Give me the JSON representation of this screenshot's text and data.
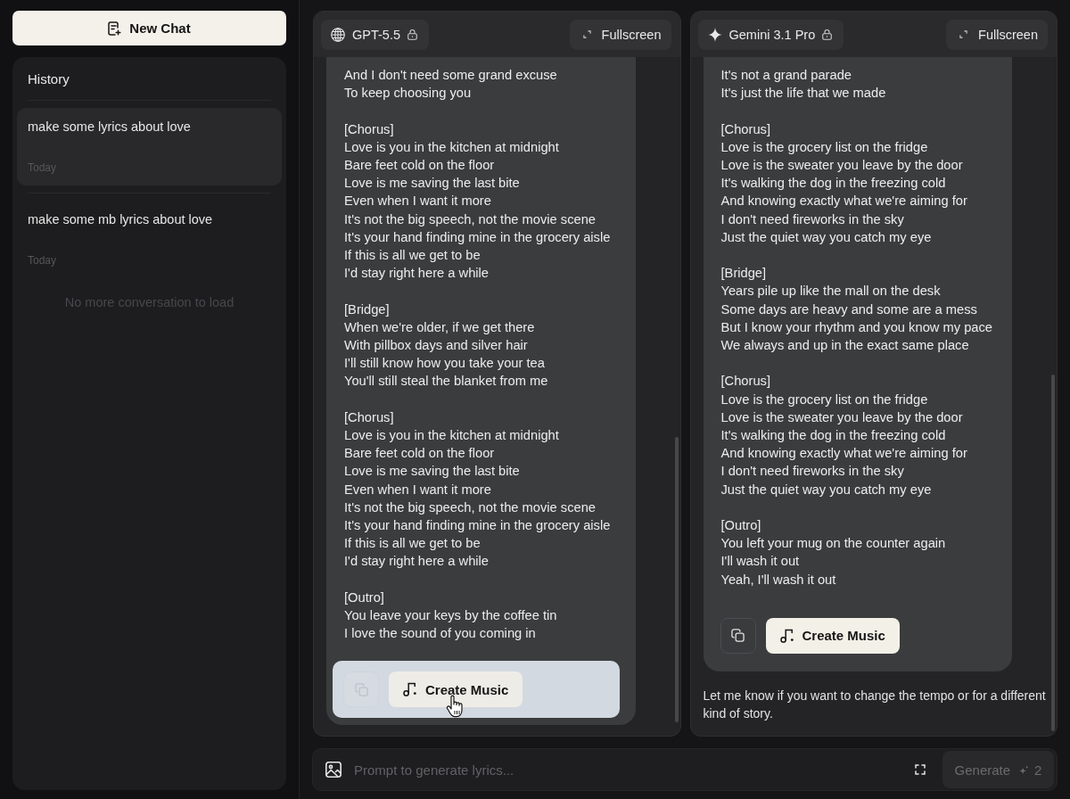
{
  "sidebar": {
    "new_chat_button": "New Chat",
    "history": {
      "title": "History",
      "items": [
        {
          "title": "make some lyrics about love",
          "date": "Today",
          "selected": true
        },
        {
          "title": "make some mb lyrics about love",
          "date": "Today",
          "selected": false
        }
      ],
      "end_note": "No more conversation to load"
    }
  },
  "panels": [
    {
      "model": {
        "name": "GPT-5.5",
        "kind": "globe",
        "locked": true
      },
      "fullscreen_button": "Fullscreen",
      "response": {
        "stanzas": [
          [
            "And I don't need some grand excuse",
            "To keep choosing you"
          ],
          [
            "[Chorus]",
            "Love is you in the kitchen at midnight",
            "Bare feet cold on the floor",
            "Love is me saving the last bite",
            "Even when I want it more",
            "It's not the big speech, not the movie scene",
            "It's your hand finding mine in the grocery aisle",
            "If this is all we get to be",
            "I'd stay right here a while"
          ],
          [
            "[Bridge]",
            "When we're older, if we get there",
            "With pillbox days and silver hair",
            "I'll still know how you take your tea",
            "You'll still steal the blanket from me"
          ],
          [
            "[Chorus]",
            "Love is you in the kitchen at midnight",
            "Bare feet cold on the floor",
            "Love is me saving the last bite",
            "Even when I want it more",
            "It's not the big speech, not the movie scene",
            "It's your hand finding mine in the grocery aisle",
            "If this is all we get to be",
            "I'd stay right here a while"
          ],
          [
            "[Outro]",
            "You leave your keys by the coffee tin",
            "I love the sound of you coming in"
          ]
        ],
        "actions": {
          "hovered": true,
          "create_music_button": "Create Music"
        }
      }
    },
    {
      "model": {
        "name": "Gemini 3.1 Pro",
        "kind": "sparkle",
        "locked": true
      },
      "fullscreen_button": "Fullscreen",
      "response": {
        "stanzas": [
          [
            "It's not a grand parade",
            "It's just the life that we made"
          ],
          [
            "[Chorus]",
            "Love is the grocery list on the fridge",
            "Love is the sweater you leave by the door",
            "It's walking the dog in the freezing cold",
            "And knowing exactly what we're aiming for",
            "I don't need fireworks in the sky",
            "Just the quiet way you catch my eye"
          ],
          [
            "[Bridge]",
            "Years pile up like the mall on the desk",
            "Some days are heavy and some are a mess",
            "But I know your rhythm and you know my pace",
            "We always and up in the exact same place"
          ],
          [
            "[Chorus]",
            "Love is the grocery list on the fridge",
            "Love is the sweater you leave by the door",
            "It's walking the dog in the freezing cold",
            "And knowing exactly what we're aiming for",
            "I don't need fireworks in the sky",
            "Just the quiet way you catch my eye"
          ],
          [
            "[Outro]",
            "You left your mug on the counter again",
            "I'll wash it out",
            "Yeah, I'll wash it out"
          ]
        ],
        "actions": {
          "hovered": false,
          "create_music_button": "Create Music"
        }
      },
      "closing_note": "Let me know if you want to change the tempo or for a different kind of story."
    }
  ],
  "prompt_bar": {
    "placeholder": "Prompt to generate lyrics...",
    "generate_button": {
      "label": "Generate",
      "credits": "2",
      "disabled": true
    }
  }
}
